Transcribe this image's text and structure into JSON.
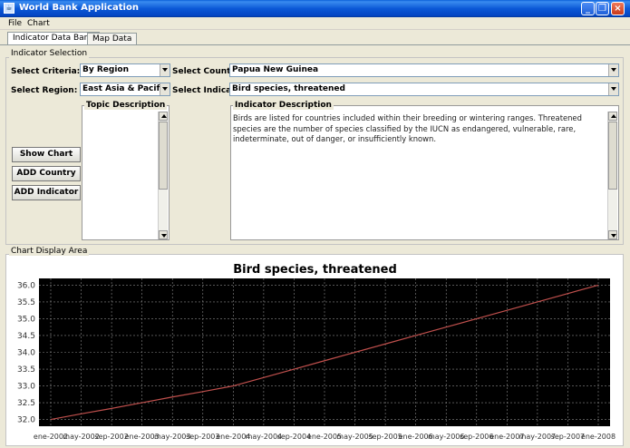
{
  "window": {
    "title": "World Bank Application"
  },
  "menu": {
    "file": "File",
    "chart": "Chart"
  },
  "tabs": [
    {
      "label": "Indicator Data Bank",
      "active": true
    },
    {
      "label": "Map Data",
      "active": false
    }
  ],
  "selection": {
    "legend": "Indicator Selection",
    "criteria_label": "Select Criteria:",
    "criteria_value": "By Region",
    "country_label": "Select Country:",
    "country_value": "Papua New Guinea",
    "region_label": "Select Region:",
    "region_value": "East Asia & Pacific (...",
    "indicator_label": "Select Indicator:",
    "indicator_value": "Bird species, threatened"
  },
  "buttons": {
    "show_chart": "Show Chart",
    "add_country": "ADD Country",
    "add_indicator": "ADD Indicator"
  },
  "topic": {
    "title": "Topic Description",
    "text": ""
  },
  "indicator": {
    "title": "Indicator Description",
    "text": "Birds are listed for countries included within their breeding or wintering ranges. Threatened species are the number of species classified by the IUCN as endangered, vulnerable, rare, indeterminate, out of danger, or insufficiently known."
  },
  "chart_area": {
    "legend": "Chart Display Area"
  },
  "chart_data": {
    "type": "line",
    "title": "Bird species, threatened",
    "xlabel": "",
    "ylabel": "",
    "x": [
      "ene-2002",
      "may-2002",
      "sep-2002",
      "ene-2003",
      "may-2003",
      "sep-2003",
      "ene-2004",
      "may-2004",
      "sep-2004",
      "ene-2005",
      "may-2005",
      "sep-2005",
      "ene-2006",
      "may-2006",
      "sep-2006",
      "ene-2007",
      "may-2007",
      "sep-2007",
      "ene-2008"
    ],
    "series": [
      {
        "values": [
          32.0,
          32.17,
          32.33,
          32.5,
          32.67,
          32.83,
          33.0,
          33.25,
          33.5,
          33.75,
          34.0,
          34.25,
          34.5,
          34.75,
          35.0,
          35.25,
          35.5,
          35.75,
          36.0
        ],
        "color": "#c0504d"
      }
    ],
    "ylim": [
      31.8,
      36.2
    ],
    "yticks": [
      32.0,
      32.5,
      33.0,
      33.5,
      34.0,
      34.5,
      35.0,
      35.5,
      36.0
    ],
    "grid": true,
    "background": "#000000"
  }
}
